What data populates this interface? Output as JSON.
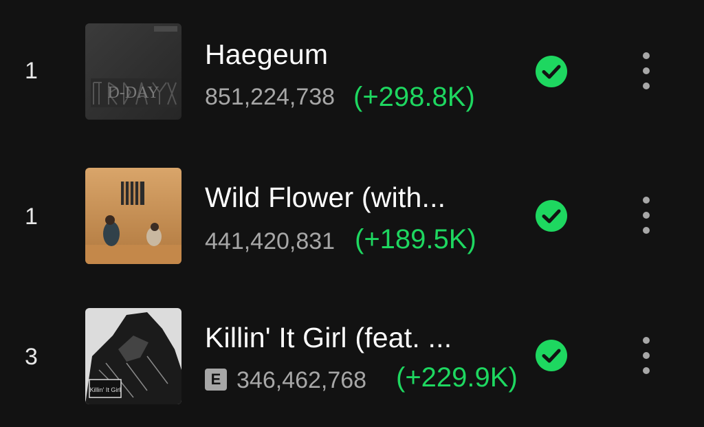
{
  "tracks": [
    {
      "rank": "1",
      "title": "Haegeum",
      "plays": "851,224,738",
      "delta": "(+298.8K)",
      "explicit": false,
      "downloaded": true,
      "cover_text": "D-DAY"
    },
    {
      "rank": "1",
      "title": "Wild Flower (with...",
      "plays": "441,420,831",
      "delta": "(+189.5K)",
      "explicit": false,
      "downloaded": true
    },
    {
      "rank": "3",
      "title": "Killin' It Girl (feat. ...",
      "plays": "346,462,768",
      "delta": "(+229.9K)",
      "explicit": true,
      "explicit_label": "E",
      "downloaded": true,
      "cover_text": "Killin' It Girl"
    }
  ],
  "colors": {
    "background": "#121212",
    "accent_green": "#1ed760",
    "secondary_text": "#a7a7a7"
  },
  "icons": {
    "downloaded": "check-circle-icon",
    "more": "more-vertical-icon"
  }
}
